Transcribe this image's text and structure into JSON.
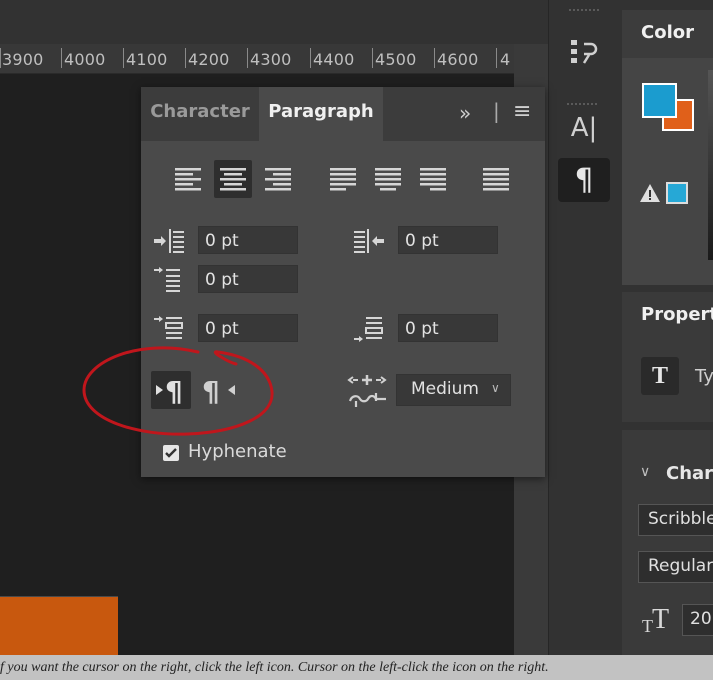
{
  "ruler": {
    "ticks": [
      "3900",
      "4000",
      "4100",
      "4200",
      "4300",
      "4400",
      "4500",
      "4600",
      "4"
    ]
  },
  "paragraph_panel": {
    "tabs": [
      "Character",
      "Paragraph"
    ],
    "active_tab": "Paragraph",
    "menu_glyphs": {
      "expand": "»",
      "separator": "|",
      "menu": "≡"
    },
    "indent_left": "0 pt",
    "indent_right": "0 pt",
    "indent_first_line": "0 pt",
    "space_before": "0 pt",
    "space_after": "0 pt",
    "justification_select": "Medium",
    "hyphenate_label": "Hyphenate",
    "hyphenate_checked": true,
    "active_alignment": "align-center"
  },
  "tool_panel": {
    "char_tool_label": "A|",
    "para_tool_glyph": "¶"
  },
  "right_dock": {
    "color_title": "Color",
    "properties_title": "Properti",
    "type_label": "Ty",
    "char_section_title": "Chara",
    "font_family": "Scribble",
    "font_style": "Regular",
    "font_size_value": "20",
    "colors": {
      "foreground": "#1b9ccf",
      "background": "#e0601a",
      "web_safe": "#26a8d6"
    }
  },
  "caption": {
    "text": "f you want the cursor on the right, click the left icon. Cursor on the left-click the icon on the right."
  }
}
